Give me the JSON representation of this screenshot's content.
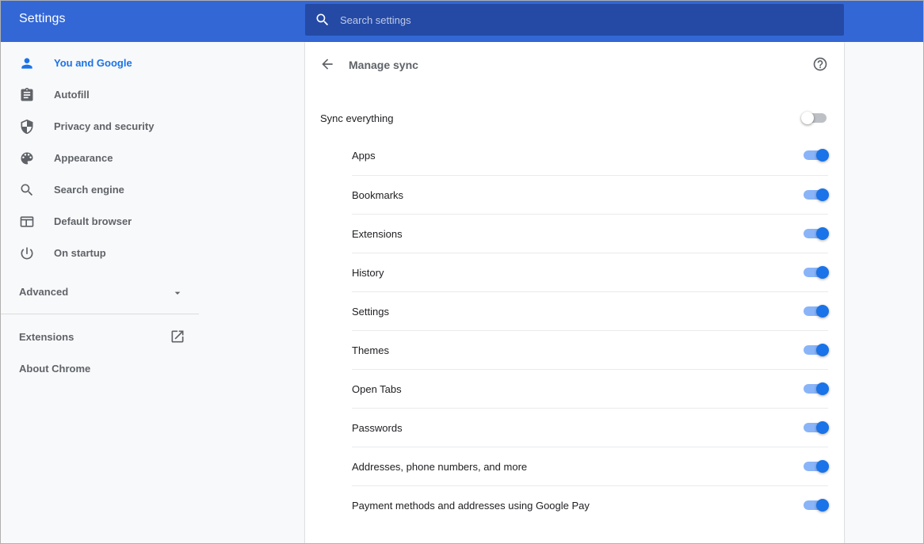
{
  "header": {
    "title": "Settings",
    "search_placeholder": "Search settings"
  },
  "sidebar": {
    "items": [
      {
        "label": "You and Google",
        "icon": "person-icon",
        "active": true
      },
      {
        "label": "Autofill",
        "icon": "clipboard-icon"
      },
      {
        "label": "Privacy and security",
        "icon": "shield-icon"
      },
      {
        "label": "Appearance",
        "icon": "palette-icon"
      },
      {
        "label": "Search engine",
        "icon": "search-icon"
      },
      {
        "label": "Default browser",
        "icon": "browser-window-icon"
      },
      {
        "label": "On startup",
        "icon": "power-icon"
      }
    ],
    "advanced_label": "Advanced",
    "extensions_label": "Extensions",
    "about_label": "About Chrome"
  },
  "main": {
    "title": "Manage sync",
    "sync_everything": {
      "label": "Sync everything",
      "enabled": false
    },
    "sync_items": [
      {
        "label": "Apps",
        "enabled": true
      },
      {
        "label": "Bookmarks",
        "enabled": true
      },
      {
        "label": "Extensions",
        "enabled": true
      },
      {
        "label": "History",
        "enabled": true
      },
      {
        "label": "Settings",
        "enabled": true
      },
      {
        "label": "Themes",
        "enabled": true
      },
      {
        "label": "Open Tabs",
        "enabled": true
      },
      {
        "label": "Passwords",
        "enabled": true
      },
      {
        "label": "Addresses, phone numbers, and more",
        "enabled": true
      },
      {
        "label": "Payment methods and addresses using Google Pay",
        "enabled": true
      }
    ]
  },
  "colors": {
    "header_bg": "#3367d6",
    "accent": "#1a73e8",
    "toggle_track_on": "#8ab4f8"
  }
}
